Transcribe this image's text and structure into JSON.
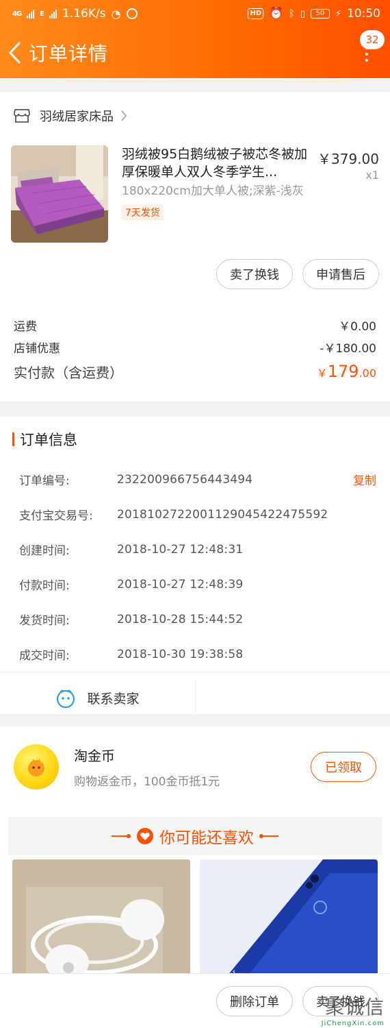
{
  "status_bar": {
    "network_1": "4G",
    "network_2": "E",
    "speed": "1.16K/s",
    "hd": "HD",
    "battery": "50",
    "time": "10:50"
  },
  "header": {
    "title": "订单详情",
    "badge_count": "32"
  },
  "shop": {
    "name": "羽绒居家床品"
  },
  "product": {
    "title": "羽绒被95白鹅绒被子被芯冬被加厚保暖单人双人冬季学生...",
    "sku": "180x220cm加大单人被;深紫-浅灰",
    "tag": "7天发货",
    "price": "￥379.00",
    "qty": "x1"
  },
  "actions": {
    "sell_label": "卖了换钱",
    "after_sale_label": "申请售后"
  },
  "fees": {
    "shipping_label": "运费",
    "shipping_value": "￥0.00",
    "discount_label": "店铺优惠",
    "discount_value": "-￥180.00",
    "total_label": "实付款（含运费）",
    "total_currency": "￥",
    "total_int": "179",
    "total_dec": ".00"
  },
  "order_info": {
    "section_title": "订单信息",
    "copy_label": "复制",
    "rows": [
      {
        "label": "订单编号:",
        "value": "232200966756443494"
      },
      {
        "label": "支付宝交易号:",
        "value": "2018102722001129045422475592"
      },
      {
        "label": "创建时间:",
        "value": "2018-10-27 12:48:31"
      },
      {
        "label": "付款时间:",
        "value": "2018-10-27 12:48:39"
      },
      {
        "label": "发货时间:",
        "value": "2018-10-28 15:44:52"
      },
      {
        "label": "成交时间:",
        "value": "2018-10-30 19:38:58"
      }
    ],
    "contact_label": "联系卖家"
  },
  "coin": {
    "title": "淘金币",
    "subtitle": "购物返金币，100金币抵1元",
    "button_label": "已领取"
  },
  "recommend": {
    "title": "你可能还喜欢"
  },
  "bottom_bar": {
    "delete_label": "删除订单",
    "sell_label": "卖了换钱"
  },
  "watermark": {
    "text": "聚诚信",
    "sub": "JiChengXin.com"
  },
  "colors": {
    "accent": "#ff5000",
    "header_start": "#ff8a1c",
    "header_end": "#ff4f00"
  }
}
